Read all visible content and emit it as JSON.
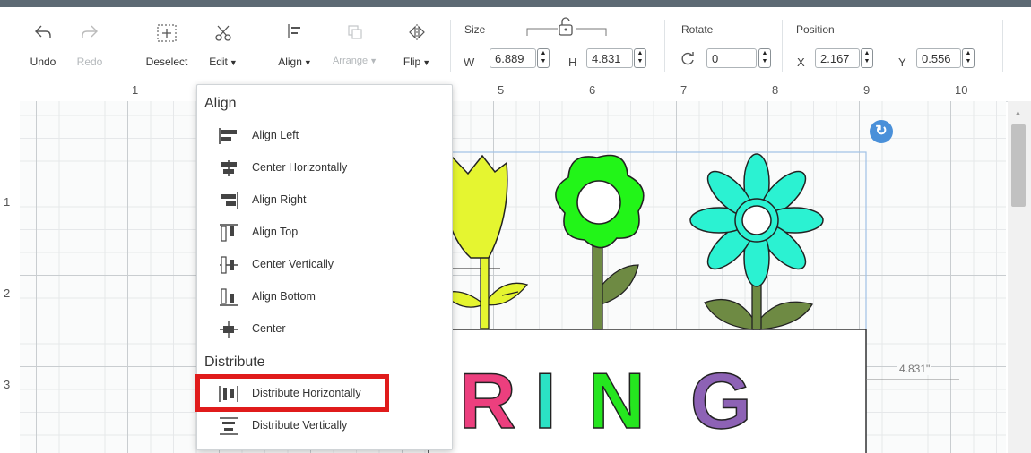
{
  "toolbar": {
    "undo": "Undo",
    "redo": "Redo",
    "deselect": "Deselect",
    "edit": "Edit",
    "align": "Align",
    "arrange": "Arrange",
    "flip": "Flip",
    "size_label": "Size",
    "w_label": "W",
    "w_value": "6.889",
    "h_label": "H",
    "h_value": "4.831",
    "rotate_label": "Rotate",
    "rotate_value": "0",
    "position_label": "Position",
    "x_label": "X",
    "x_value": "2.167",
    "y_label": "Y",
    "y_value": "0.556"
  },
  "ruler": {
    "top": [
      "1",
      "5",
      "6",
      "7",
      "8",
      "9",
      "10"
    ],
    "left": [
      "1",
      "2",
      "3"
    ]
  },
  "canvas": {
    "dimension_label": "4.831\"",
    "word_letters": [
      "R",
      "I",
      "N",
      "G"
    ],
    "letter_colors": [
      "#ec3f7e",
      "#2be2c4",
      "#25e61f",
      "#8d62b5"
    ]
  },
  "menu": {
    "align_header": "Align",
    "align_items": [
      "Align Left",
      "Center Horizontally",
      "Align Right",
      "Align Top",
      "Center Vertically",
      "Align Bottom",
      "Center"
    ],
    "distribute_header": "Distribute",
    "distribute_items": [
      "Distribute Horizontally",
      "Distribute Vertically"
    ]
  },
  "colors": {
    "highlight": "#e01b1b",
    "tulip": "#e5f530",
    "flower_green": "#22f518",
    "flower_aqua": "#2bf2d2",
    "leaf": "#6e8a43"
  }
}
